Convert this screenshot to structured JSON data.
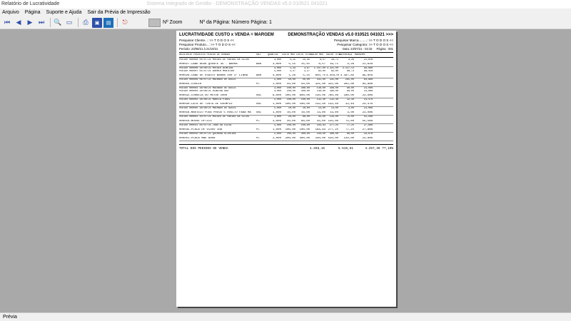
{
  "window": {
    "title": "Relatório de Lucratividade",
    "ghost_title": "Sistema Integrado de Gestão - DEMONSTRAÇÃO VENDAS v5.0 010521 041021"
  },
  "menu": [
    "Arquivo",
    "Página",
    "Suporte e Ajuda",
    "Sair da Prévia de Impressão"
  ],
  "toolbar": {
    "zoom_label": "Nº Zoom",
    "page_label": "Nº da Página: Número Página: 1"
  },
  "status": "Prévia",
  "report": {
    "title": "LUCRATIVIDADE CUSTO x VENDA = MARGEM",
    "subtitle": "DEMONSTRAÇÃO VENDAS v5.0 010521 041021 >>>",
    "filter_left_1": "Pesquisar Cliente...: >> T O D O S <<",
    "filter_left_2": "Pesquisar Produto...: >> T O D O S <<",
    "filter_right_1": "Pesquisar Marca.........: >> T O D O S <<",
    "filter_right_2": "Pesquisar Categoria: >> T O D O S <<",
    "period": "Período: 23/08/21 à 21/10/21",
    "date": "Data: 23/07/21 - 02:32",
    "page_no": "Página : 001",
    "columns": [
      "RELATÓRIO PRODUTOS PEDIDO DE VENDAS",
      "UNI",
      "QUANTIA",
      "CUSTO MED",
      "CUSTO TOTAL",
      "VALOR MED",
      "VALOR TOTAL",
      "DIFERENÇA",
      "MARGEM%"
    ],
    "rows": [
      {
        "kind": "pedido",
        "cells": [
          "PEDIDO 000008 05/07/21 MOISÉS DE FARIAS DA SILVA",
          "",
          "3,000",
          "5,15",
          "15,45",
          "6,57",
          "19,71",
          "4,26",
          "21,61%"
        ]
      },
      {
        "kind": "produto",
        "cells": [
          "000027-CABO AGUA QUENTE 35 - BARRA",
          "BAR",
          "3,000",
          "5,15",
          "15,45",
          "6,57",
          "19,71",
          "4,26",
          "21,61%"
        ]
      },
      {
        "kind": "pedido",
        "cells": [
          "PEDIDO 000006 28/06/21 MOISÉS ALMEIDA",
          "",
          "3,000",
          "1,29",
          "3,87",
          "1.107,00",
          "3.321,00",
          "3.317,13",
          "99,88%"
        ]
      },
      {
        "kind": "pedido",
        "cells": [
          "PEDIDO 000007 01/07/21 ADEMIR MONTEIRO",
          "",
          "1,000",
          "1,27",
          "1,27",
          "82,00",
          "82,00",
          "80,73",
          "98,45%"
        ]
      },
      {
        "kind": "produto",
        "cells": [
          "000026-CANO DE ESGOTO BARRA 100 3\" LINHA",
          "BAR",
          "4,000",
          "1,29",
          "5,15",
          "850,75",
          "3.403,00",
          "3.397,85",
          "99,85%"
        ]
      },
      {
        "kind": "pedido",
        "cells": [
          "PEDIDO 000009 06/07/21 MACHADO DE ASSIS",
          "",
          "1,000",
          "50,00",
          "50,00",
          "331,00",
          "331,00",
          "281,00",
          "84,89%"
        ]
      },
      {
        "kind": "produto",
        "cells": [
          "000055-COOLER",
          "PC",
          "1,000",
          "50,00",
          "50,00",
          "331,00",
          "331,00",
          "281,00",
          "84,89%"
        ]
      },
      {
        "kind": "pedido",
        "cells": [
          "PEDIDO 000003 28/06/21 MACHADO DE ASSIS",
          "",
          "3,000",
          "100,00",
          "300,00",
          "130,00",
          "390,00",
          "90,00",
          "23,08%"
        ]
      },
      {
        "kind": "pedido",
        "cells": [
          "PEDIDO 000004 28/06/21 RIBEIRA DAS",
          "",
          "3,000",
          "100,00",
          "300,00",
          "130,00",
          "390,00",
          "90,00",
          "23,08%"
        ]
      },
      {
        "kind": "produto",
        "cells": [
          "000032-CORREIA DO MOTOR 1000",
          "UNI",
          "6,000",
          "100,00",
          "600,00",
          "130,00",
          "780,00",
          "180,00",
          "23,08%"
        ]
      },
      {
        "kind": "pedido",
        "cells": [
          "PEDIDO 000002 28/06/21 MARCIA PIRES",
          "",
          "1,000",
          "100,00",
          "100,00",
          "132,40",
          "132,40",
          "32,40",
          "24,47%"
        ]
      },
      {
        "kind": "produto",
        "cells": [
          "000030-LATA DE TINTA DE EXEMPLO",
          "UNI",
          "1,000",
          "100,00",
          "100,00",
          "132,40",
          "132,40",
          "32,40",
          "24,47%"
        ]
      },
      {
        "kind": "pedido",
        "cells": [
          "PEDIDO 000005 28/06/21 MACHADO DE ASSIS",
          "",
          "1,000",
          "10,00",
          "10,00",
          "13,00",
          "13,00",
          "3,00",
          "23,08%"
        ]
      },
      {
        "kind": "produto",
        "cells": [
          "000016-MARTELO PUXA PREGO 5 ROSCTO FABA MA",
          "UNI",
          "1,000",
          "10,00",
          "10,00",
          "13,00",
          "13,00",
          "3,00",
          "23,08%"
        ]
      },
      {
        "kind": "pedido",
        "cells": [
          "PEDIDO 000001 20/07/21 MOISÉS DE FARIAS DA SILVA",
          "",
          "3,000",
          "20,00",
          "60,00",
          "45,00",
          "135,00",
          "75,00",
          "55,56%"
        ]
      },
      {
        "kind": "produto",
        "cells": [
          "000010-MOUSE OPTICO",
          "PC",
          "3,000",
          "20,00",
          "60,00",
          "45,00",
          "135,00",
          "75,00",
          "55,56%"
        ]
      },
      {
        "kind": "pedido",
        "cells": [
          "PEDIDO 000011 05/07/21 JOÃO DA SILVA",
          "",
          "1,000",
          "100,00",
          "100,00",
          "184,83",
          "277,25",
          "77,25",
          "27,86%"
        ]
      },
      {
        "kind": "produto",
        "cells": [
          "000035-PLACA DE VIDEO 1GB",
          "PC",
          "1,000",
          "100,00",
          "100,00",
          "184,83",
          "277,25",
          "77,25",
          "27,86%"
        ]
      },
      {
        "kind": "pedido",
        "cells": [
          "PEDIDO 000010 08/07/21 QUIROGA OLIVEIRA",
          "",
          "2,000",
          "200,00",
          "400,00",
          "240,00",
          "480,00",
          "80,00",
          "16,67%"
        ]
      },
      {
        "kind": "produto",
        "cells": [
          "000051-PLACA MÃE 8000",
          "PC",
          "2,000",
          "200,00",
          "400,00",
          "240,00",
          "520,00",
          "120,00",
          "23,08%"
        ]
      }
    ],
    "total": {
      "label": "TOTAL DOS PEDIDOS DE VENDA",
      "cost": "1.258,15",
      "value": "5.515,51",
      "diff": "4.257,36",
      "margin": "77,19%"
    }
  }
}
